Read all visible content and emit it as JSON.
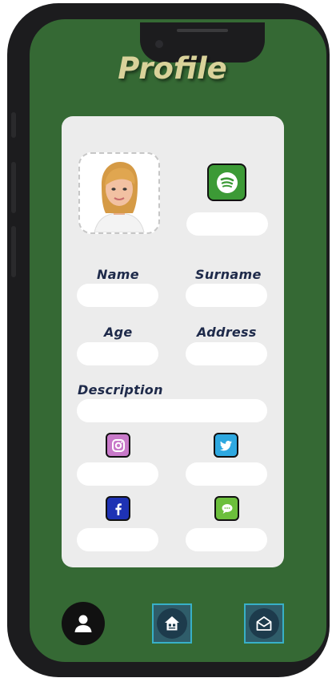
{
  "app": {
    "title": "Profile"
  },
  "labels": {
    "name": "Name",
    "surname": "Surname",
    "age": "Age",
    "address": "Address",
    "description": "Description"
  },
  "fields": {
    "spotify": "",
    "name": "",
    "surname": "",
    "age": "",
    "address": "",
    "description": "",
    "instagram": "",
    "twitter": "",
    "facebook": "",
    "messages": ""
  },
  "icons": {
    "spotify": "spotify-icon",
    "instagram": "instagram-icon",
    "twitter": "twitter-icon",
    "facebook": "facebook-icon",
    "messages": "chat-icon",
    "nav": [
      "user-icon",
      "home-icon",
      "mail-open-icon"
    ]
  },
  "colors": {
    "background": "#356934",
    "title": "#d9d29a",
    "card": "#ececec",
    "label": "#1e2a4a",
    "spotify": "#3c9a36",
    "instagram": "#c879c9",
    "twitter": "#2ea8e0",
    "facebook": "#1e32b4",
    "messages": "#6cbf3c",
    "nav_accent": "#38b0c7"
  }
}
